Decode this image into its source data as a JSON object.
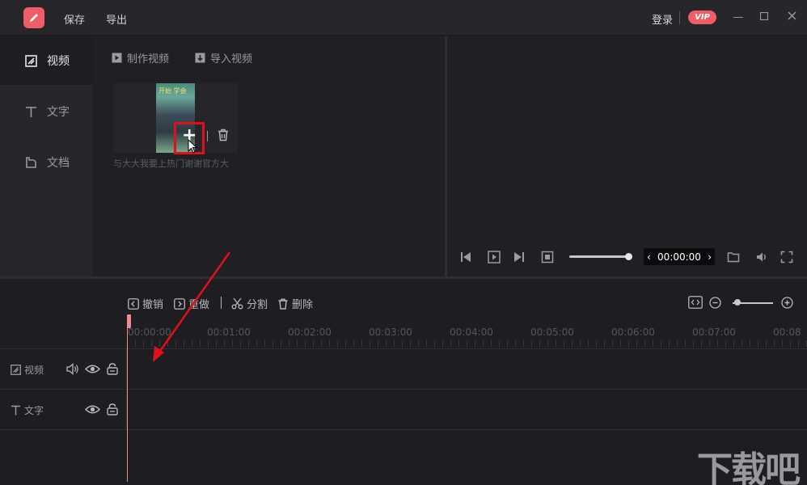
{
  "titlebar": {
    "menu": [
      "保存",
      "导出"
    ],
    "login": "登录",
    "vip": "VIP"
  },
  "leftnav": {
    "items": [
      {
        "label": "视频",
        "icon": "video-icon",
        "active": true
      },
      {
        "label": "文字",
        "icon": "text-icon",
        "active": false
      },
      {
        "label": "文档",
        "icon": "document-icon",
        "active": false
      }
    ]
  },
  "media": {
    "tabs": [
      "制作视频",
      "导入视频"
    ],
    "thumb_title": "与大大我要上热门谢谢官方大",
    "thumb_overlay": "开始 学会"
  },
  "preview": {
    "time": "00:00:00"
  },
  "toolbar": {
    "undo": "撤销",
    "redo": "重做",
    "split": "分割",
    "delete": "删除"
  },
  "ruler": [
    "00:00:00",
    "00:01:00",
    "00:02:00",
    "00:03:00",
    "00:04:00",
    "00:05:00",
    "00:06:00",
    "00:07:00",
    "00:08"
  ],
  "tracks": {
    "video": "视频",
    "text": "文字"
  },
  "watermark": "下载吧",
  "colors": {
    "accent": "#f05d66",
    "highlight": "#e0111b",
    "background": "#1e1e22"
  }
}
